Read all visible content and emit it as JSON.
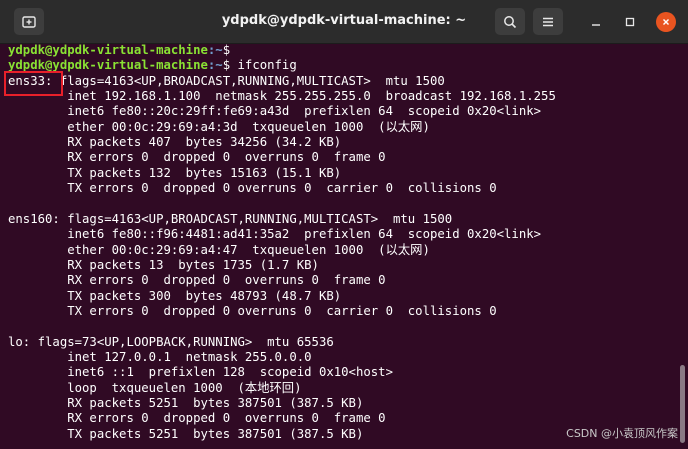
{
  "window": {
    "title": "ydpdk@ydpdk-virtual-machine: ~",
    "icons": {
      "new_tab": "new-tab-icon",
      "search": "search-icon",
      "menu": "hamburger-menu-icon",
      "minimize": "minimize-icon",
      "maximize": "maximize-icon",
      "close": "close-icon"
    }
  },
  "terminal": {
    "prompt_user": "ydpdk@ydpdk-virtual-machine",
    "prompt_path": ":~",
    "prompt_symbol": "$",
    "command": " ifconfig",
    "lines": [
      "ens33: flags=4163<UP,BROADCAST,RUNNING,MULTICAST>  mtu 1500",
      "        inet 192.168.1.100  netmask 255.255.255.0  broadcast 192.168.1.255",
      "        inet6 fe80::20c:29ff:fe69:a43d  prefixlen 64  scopeid 0x20<link>",
      "        ether 00:0c:29:69:a4:3d  txqueuelen 1000  (以太网)",
      "        RX packets 407  bytes 34256 (34.2 KB)",
      "        RX errors 0  dropped 0  overruns 0  frame 0",
      "        TX packets 132  bytes 15163 (15.1 KB)",
      "        TX errors 0  dropped 0 overruns 0  carrier 0  collisions 0",
      "",
      "ens160: flags=4163<UP,BROADCAST,RUNNING,MULTICAST>  mtu 1500",
      "        inet6 fe80::f96:4481:ad41:35a2  prefixlen 64  scopeid 0x20<link>",
      "        ether 00:0c:29:69:a4:47  txqueuelen 1000  (以太网)",
      "        RX packets 13  bytes 1735 (1.7 KB)",
      "        RX errors 0  dropped 0  overruns 0  frame 0",
      "        TX packets 300  bytes 48793 (48.7 KB)",
      "        TX errors 0  dropped 0 overruns 0  carrier 0  collisions 0",
      "",
      "lo: flags=73<UP,LOOPBACK,RUNNING>  mtu 65536",
      "        inet 127.0.0.1  netmask 255.0.0.0",
      "        inet6 ::1  prefixlen 128  scopeid 0x10<host>",
      "        loop  txqueuelen 1000  (本地环回)",
      "        RX packets 5251  bytes 387501 (387.5 KB)",
      "        RX errors 0  dropped 0  overruns 0  frame 0",
      "        TX packets 5251  bytes 387501 (387.5 KB)"
    ]
  },
  "watermark": "CSDN @小袁顶风作案",
  "colors": {
    "terminal_bg": "#300a24",
    "prompt_user": "#8ae234",
    "prompt_path": "#729fcf",
    "highlight_box": "#e8202a",
    "close_button": "#e95420"
  }
}
